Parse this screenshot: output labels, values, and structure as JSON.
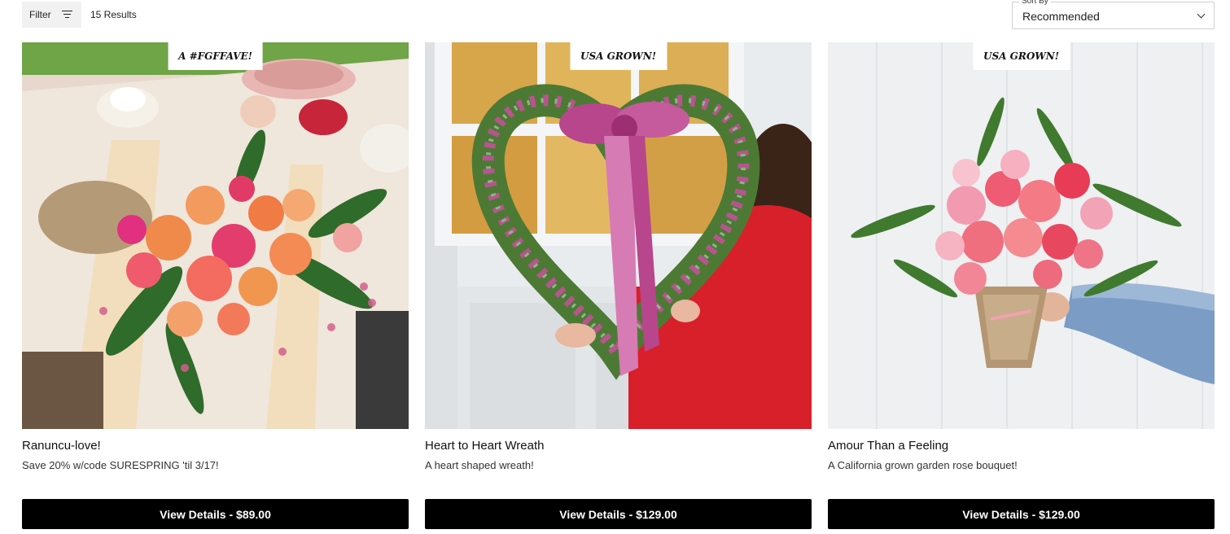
{
  "toolbar": {
    "filter_label": "Filter",
    "results_count": "15 Results",
    "sort_label": "Sort By",
    "sort_value": "Recommended"
  },
  "products": [
    {
      "badge": "A #FGFFAVE!",
      "title": "Ranuncu-love!",
      "description": "Save 20% w/code SURESPRING 'til 3/17!",
      "button_label": "View Details - $89.00"
    },
    {
      "badge": "USA GROWN!",
      "title": "Heart to Heart Wreath",
      "description": "A heart shaped wreath!",
      "button_label": "View Details - $129.00"
    },
    {
      "badge": "USA GROWN!",
      "title": "Amour Than a Feeling",
      "description": "A California grown garden rose bouquet!",
      "button_label": "View Details - $129.00"
    }
  ],
  "colors": {
    "button_bg": "#000000",
    "filter_bg": "#f1f1f1"
  }
}
